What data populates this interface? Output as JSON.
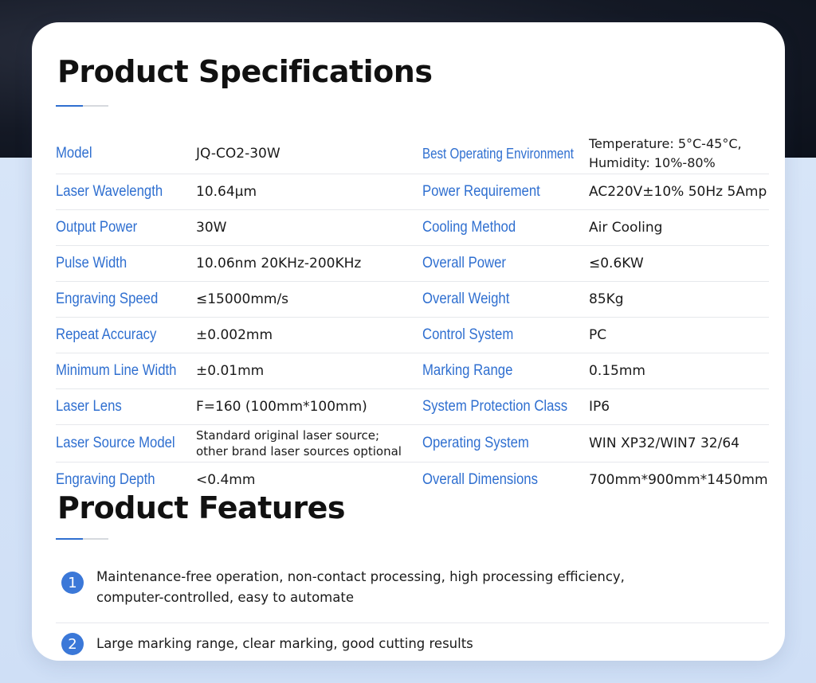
{
  "specifications": {
    "title": "Product Specifications",
    "rows": [
      {
        "label1": "Model",
        "value1": "JQ-CO2-30W",
        "label2": "Best Operating Environment",
        "value2": "Temperature: 5°C-45°C,\nHumidity: 10%-80%"
      },
      {
        "label1": "Laser Wavelength",
        "value1": "10.64μm",
        "label2": "Power Requirement",
        "value2": "AC220V±10% 50Hz 5Amp"
      },
      {
        "label1": "Output Power",
        "value1": "30W",
        "label2": "Cooling Method",
        "value2": "Air Cooling"
      },
      {
        "label1": "Pulse Width",
        "value1": "10.06nm 20KHz-200KHz",
        "label2": "Overall Power",
        "value2": "≤0.6KW"
      },
      {
        "label1": "Engraving Speed",
        "value1": "≤15000mm/s",
        "label2": "Overall Weight",
        "value2": "85Kg"
      },
      {
        "label1": "Repeat Accuracy",
        "value1": "±0.002mm",
        "label2": "Control System",
        "value2": "PC"
      },
      {
        "label1": "Minimum Line Width",
        "value1": "±0.01mm",
        "label2": "Marking Range",
        "value2": "0.15mm"
      },
      {
        "label1": "Laser Lens",
        "value1": "F=160 (100mm*100mm)",
        "label2": "System Protection Class",
        "value2": "IP6"
      },
      {
        "label1": "Laser Source Model",
        "value1": "Standard original laser source;\nother brand laser sources optional",
        "label2": "Operating System",
        "value2": "WIN XP32/WIN7 32/64"
      },
      {
        "label1": "Engraving Depth",
        "value1": "<0.4mm",
        "label2": "Overall Dimensions",
        "value2": "700mm*900mm*1450mm"
      }
    ]
  },
  "features": {
    "title": "Product Features",
    "items": [
      {
        "number": "1",
        "text": "Maintenance-free operation, non-contact processing, high processing efficiency,\ncomputer-controlled, easy to automate"
      },
      {
        "number": "2",
        "text": "Large marking range, clear marking, good cutting results"
      }
    ]
  }
}
